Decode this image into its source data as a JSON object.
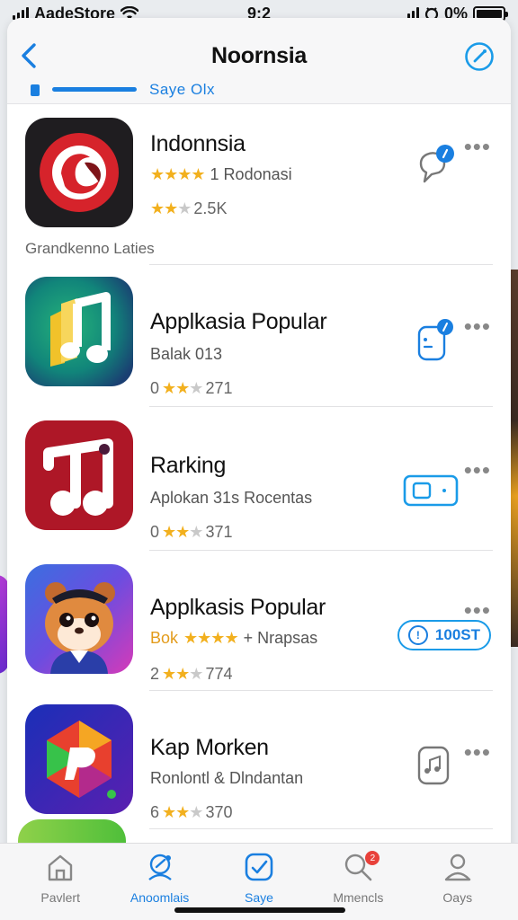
{
  "status_bar": {
    "carrier": "AadeStore",
    "time": "9:2",
    "battery": "0%"
  },
  "header": {
    "title": "Noornsia",
    "segment_label": "Saye  Olx"
  },
  "section_caption": "Grandkenno Laties",
  "apps": [
    {
      "name": "Indonnsia",
      "subtitle_stars": "★★★★",
      "subtitle_text": "1  Rodonasi",
      "rating_text": "2.5K",
      "action": "chat-badge-icon"
    },
    {
      "name": "Applkasia Popular",
      "subtitle_text": "Balak  013",
      "rating_prefix": "0",
      "rating_text": "271",
      "action": "device-badge-icon"
    },
    {
      "name": "Rarking",
      "subtitle_text": "Aplokan  31s  Rocentas",
      "rating_prefix": "0",
      "rating_text": "371",
      "action": "ticket-icon"
    },
    {
      "name": "Applkasis Popular",
      "subtitle_prefix": "Bok",
      "subtitle_stars": "★★★★",
      "subtitle_text": "+  Nrapsas",
      "rating_prefix": "2",
      "rating_text": "774",
      "action_label": "100ST"
    },
    {
      "name": "Kap Morken",
      "subtitle_text": "Ronlontl  &  Dlndantan",
      "rating_prefix": "6",
      "rating_text": "370",
      "action": "music-note-icon"
    }
  ],
  "tabs": [
    {
      "label": "Pavlert",
      "icon": "home-icon",
      "active": false
    },
    {
      "label": "Anoomlais",
      "icon": "compass-person-icon",
      "active": true
    },
    {
      "label": "Saye",
      "icon": "check-box-icon",
      "active": true
    },
    {
      "label": "Mmencls",
      "icon": "search-icon",
      "active": false,
      "badge": "2"
    },
    {
      "label": "Oays",
      "icon": "person-icon",
      "active": false
    }
  ],
  "colors": {
    "accent": "#1a7fe0",
    "star": "#f2b01e",
    "badge": "#e8413a"
  }
}
